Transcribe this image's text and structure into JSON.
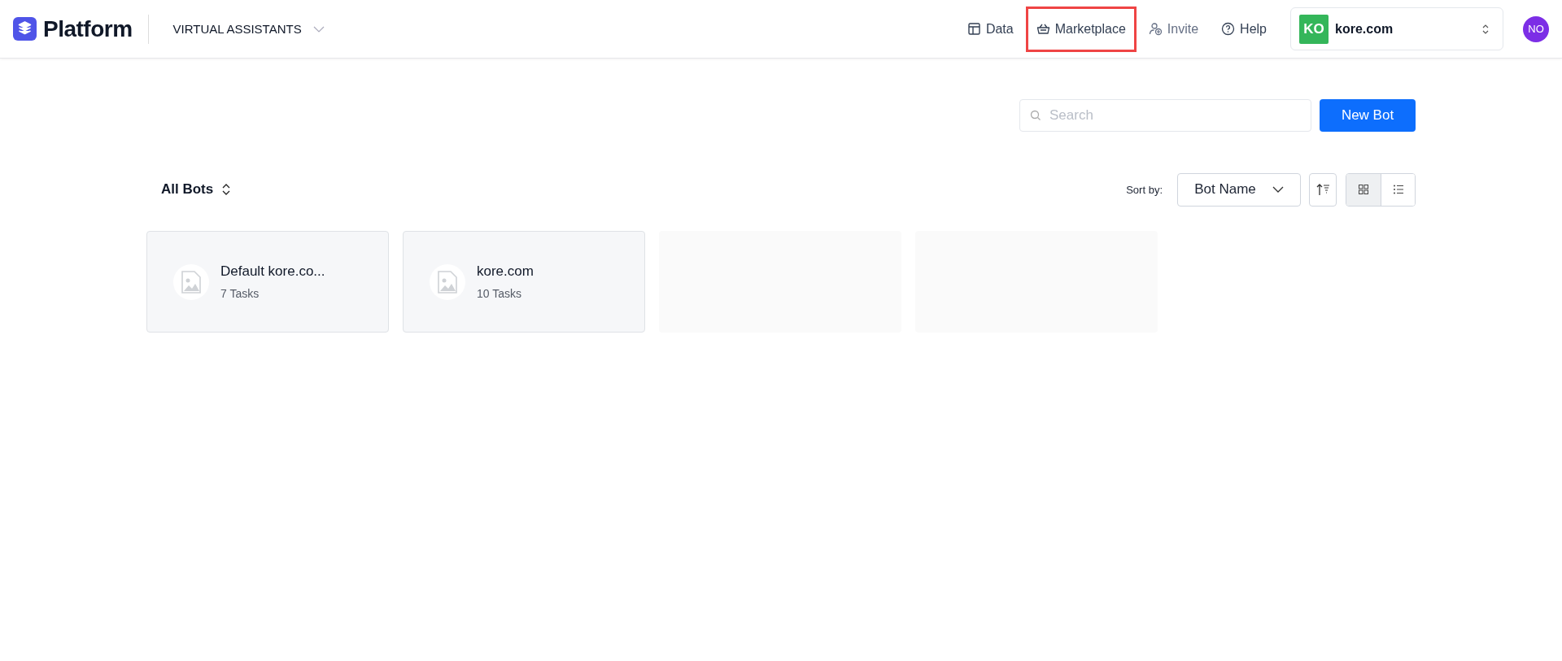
{
  "header": {
    "logo": "Platform",
    "product": "VIRTUAL ASSISTANTS",
    "nav": [
      {
        "kind": "data",
        "label": "Data",
        "disabled": false,
        "highlighted": false
      },
      {
        "kind": "marketplace",
        "label": "Marketplace",
        "disabled": false,
        "highlighted": true
      },
      {
        "kind": "invite",
        "label": "Invite",
        "disabled": true,
        "highlighted": false
      },
      {
        "kind": "help",
        "label": "Help",
        "disabled": false,
        "highlighted": false
      }
    ],
    "workspace": {
      "initials": "KO",
      "name": "kore.com"
    },
    "user_initials": "NO"
  },
  "search": {
    "placeholder": "Search"
  },
  "new_button": "New Bot",
  "filter": "All Bots",
  "sort_label": "Sort by:",
  "sort_value": "Bot Name",
  "views": [
    {
      "kind": "grid",
      "selected": true
    },
    {
      "kind": "list",
      "selected": false
    }
  ],
  "cards": [
    {
      "kind": "bot",
      "name": "Default kore.co...",
      "tasks": "7 Tasks"
    },
    {
      "kind": "bot",
      "name": "kore.com",
      "tasks": "10 Tasks"
    },
    {
      "kind": "placeholder"
    },
    {
      "kind": "placeholder"
    }
  ]
}
